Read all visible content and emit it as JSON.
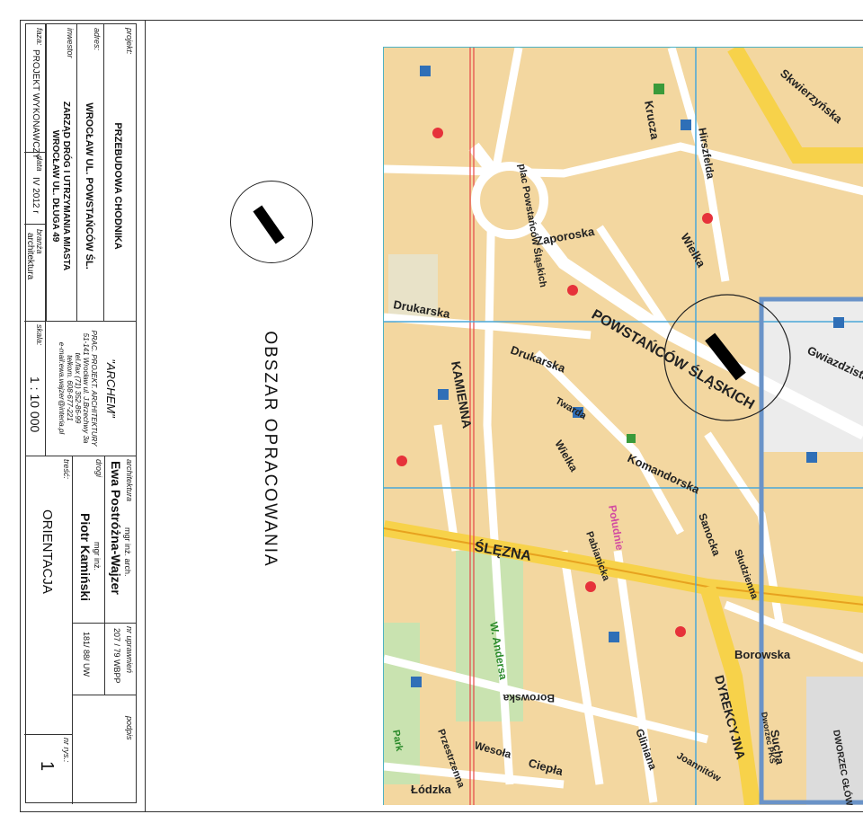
{
  "title_block": {
    "projekt_label": "projekt:",
    "projekt_value": "PRZEBUDOWA CHODNIKA",
    "adres_label": "adres:",
    "adres_value": "WROCŁAW UL. POWSTAŃCÓW ŚL.",
    "inwestor_label": "inwestor",
    "inwestor_line1": "ZARZĄD DRÓG I UTRZYMANIA MIASTA",
    "inwestor_line2": "WROCŁAW UL. DŁUGA 49",
    "faza_label": "faza:",
    "faza_value": "PROJEKT WYKONAWCZY",
    "data_label": "data",
    "data_value": "IV 2012 r",
    "branza_label": "branża",
    "branza_value": "architektura",
    "skala_label": "skala:",
    "skala_value": "1 : 10 000",
    "company_name": "\"ARCHEM\"",
    "company_line1": "PRAC. PROJEKT. ARCHITEKTURY",
    "company_line2": "51-141 Wrocław ul. J.Brzechwy 3a",
    "company_line3": "tel./fax (71) 352-86-99",
    "company_line4": "telkom. 608-677-221",
    "company_line5": "e-mail:ewa.wajzer@interia.pl",
    "architektura_label": "architektura",
    "arch_title": "mgr inż. arch.",
    "arch_name": "Ewa Postróżna-Wajzer",
    "nr_upr_label": "nr uprawnień",
    "arch_nr": "207 / 79 WBPP",
    "podpis_label": "podpis",
    "drogi_label": "drogi",
    "drogi_title": "mgr inż.",
    "drogi_name": "Piotr Kamiński",
    "drogi_nr": "181/ 88/ UW",
    "tresc_label": "treść:",
    "tresc_value": "ORIENTACJA",
    "nr_rys_label": "nr rys.:",
    "nr_rys_value": "1"
  },
  "area_label": "OBSZAR OPRACOWANIA",
  "map": {
    "streets": {
      "powstancow": "POWSTAŃCÓW ŚLĄSKICH",
      "slezna": "ŚLĘZNA",
      "kamienna": "KAMIENNA",
      "dyrekcyjna": "DYREKCYJNA",
      "borowska": "Borowska",
      "borowska2": "Borowska",
      "sucha": "Sucha",
      "glinianna": "Gliniana",
      "wielka": "Wielka",
      "drukarska": "Drukarska",
      "komandorska": "Komandorska",
      "gwiazdzista": "Gwiazdzista",
      "zaporoska": "Zaporoska",
      "krucza": "Krucza",
      "hirszfelda": "Hirszfelda",
      "lodzka": "Łódzka",
      "ciepla": "Ciepła",
      "wesola": "Wesoła",
      "sanocka": "Sanocka",
      "pabianicka": "Pabianicka",
      "sludzienna": "Słudzienna",
      "skwierzynska": "Skwierzyńska",
      "plac": "plac Powstańców Śląskich",
      "park": "Park",
      "anders": "W. Andersa",
      "joannitow": "Joannitów",
      "przestrzenna": "Przestrzenna",
      "twarda": "Twarda",
      "dworzec": "DWORZEC GŁÓWNY",
      "dworzec_pks": "Dworzec PKS",
      "poludnie": "Południe"
    }
  }
}
